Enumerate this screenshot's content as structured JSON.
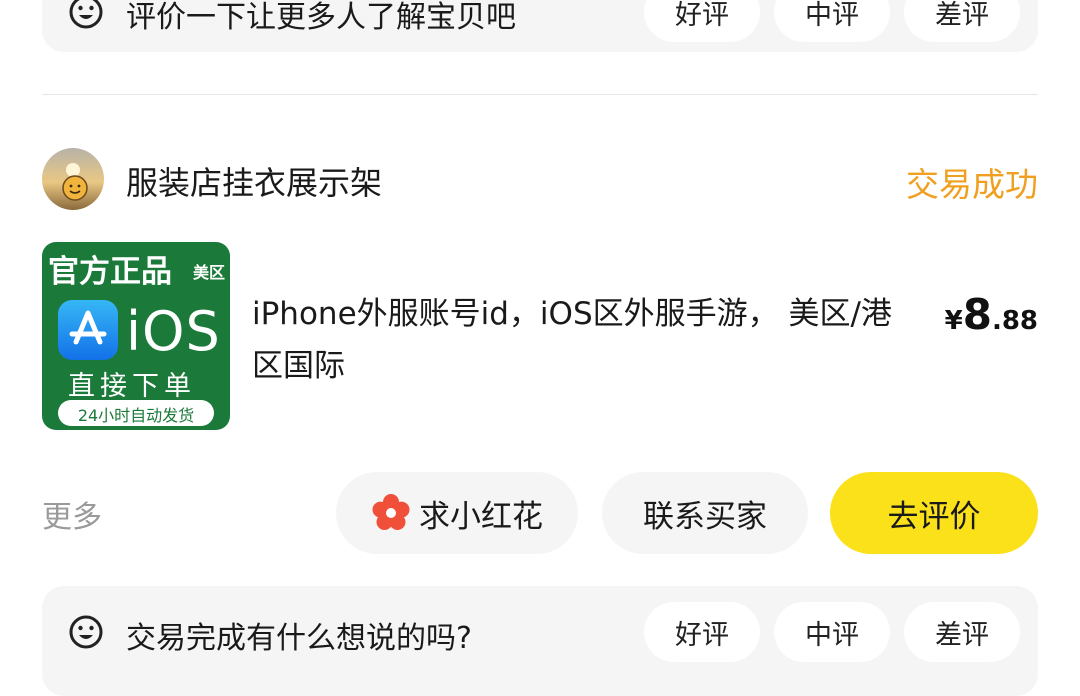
{
  "top_prompt": {
    "text": "评价一下让更多人了解宝贝吧",
    "buttons": [
      "好评",
      "中评",
      "差评"
    ]
  },
  "order": {
    "seller_name": "服装店挂衣展示架",
    "status": "交易成功",
    "status_color": "#f0a020",
    "thumbnail": {
      "title": "官方正品",
      "region": "美区",
      "platform": "iOS",
      "order_text": "直接下单",
      "band": "24小时自动发货"
    },
    "description": "iPhone外服账号id，iOS区外服手游， 美区/港区国际",
    "price": {
      "symbol": "¥",
      "integer": "8",
      "decimal": ".88"
    },
    "actions": {
      "more": "更多",
      "flower": "求小红花",
      "contact": "联系买家",
      "review": "去评价"
    },
    "accent_color": "#fbe11a"
  },
  "bottom_prompt": {
    "text": "交易完成有什么想说的吗?",
    "buttons": [
      "好评",
      "中评",
      "差评"
    ]
  }
}
